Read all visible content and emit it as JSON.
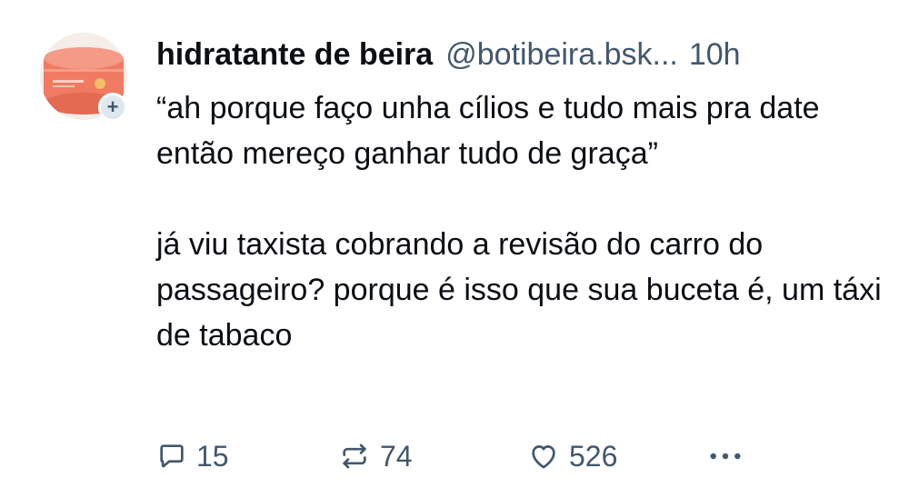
{
  "post": {
    "author": {
      "display_name": "hidratante de beira",
      "handle": "@botibeira.bsk...",
      "time": "10h",
      "avatar_icon": "peach-cosmetic-jar-avatar",
      "follow_icon": "plus-icon"
    },
    "text_paragraphs": [
      "“ah porque faço unha cílios e tudo mais pra date então mereço ganhar tudo de graça”",
      "já viu taxista cobrando a revisão do carro do passageiro? porque é isso que sua buceta é, um táxi de tabaco"
    ],
    "actions": {
      "reply": {
        "icon": "reply-icon",
        "count": "15"
      },
      "repost": {
        "icon": "repost-icon",
        "count": "74"
      },
      "like": {
        "icon": "heart-icon",
        "count": "526"
      },
      "more": {
        "icon": "more-options-icon"
      }
    }
  },
  "colors": {
    "text": "#0b0f14",
    "secondary": "#42576c",
    "avatar_accent": "#f07a62"
  }
}
